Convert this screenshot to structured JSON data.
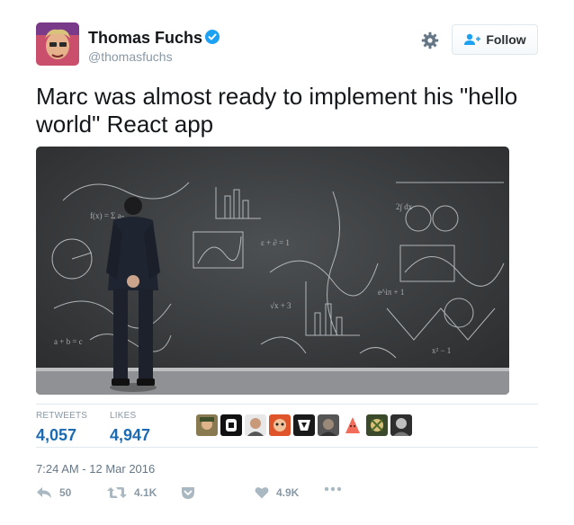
{
  "user": {
    "name": "Thomas Fuchs",
    "handle": "@thomasfuchs",
    "verified_icon": "verified-badge-icon"
  },
  "header": {
    "follow_label": "Follow",
    "settings_icon": "gear-icon"
  },
  "tweet": {
    "text": "Marc was almost ready to implement his \"hello world\" React app"
  },
  "stats": {
    "retweets_label": "RETWEETS",
    "retweets_value": "4,057",
    "likes_label": "LIKES",
    "likes_value": "4,947"
  },
  "timestamp": "7:24 AM - 12 Mar 2016",
  "actions": {
    "reply_count": "50",
    "retweet_count": "4.1K",
    "like_count": "4.9K"
  },
  "colors": {
    "link_blue": "#1b6bb3",
    "muted": "#8899a6",
    "verified": "#1da1f2"
  }
}
